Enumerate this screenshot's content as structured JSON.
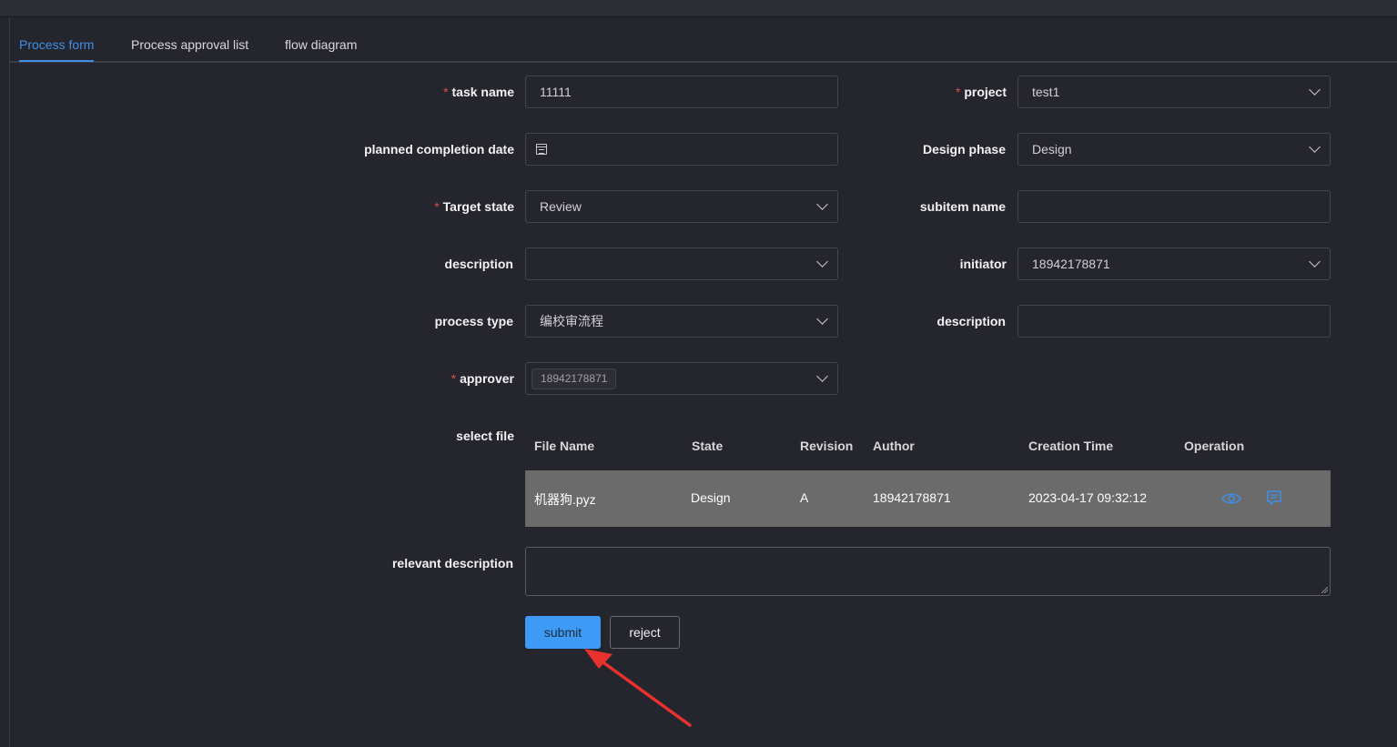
{
  "tabs": [
    {
      "label": "Process form",
      "active": true
    },
    {
      "label": "Process approval list",
      "active": false
    },
    {
      "label": "flow diagram",
      "active": false
    }
  ],
  "form": {
    "task_name": {
      "label": "task name",
      "required": "*",
      "value": "11111"
    },
    "project": {
      "label": "project",
      "required": "*",
      "value": "test1"
    },
    "planned_completion_date": {
      "label": "planned completion date",
      "value": ""
    },
    "design_phase": {
      "label": "Design phase",
      "value": "Design"
    },
    "target_state": {
      "label": "Target state",
      "required": "*",
      "value": "Review"
    },
    "subitem_name": {
      "label": "subitem name",
      "value": ""
    },
    "description_left": {
      "label": "description",
      "value": ""
    },
    "initiator": {
      "label": "initiator",
      "value": "18942178871"
    },
    "process_type": {
      "label": "process type",
      "value": "编校审流程"
    },
    "description_right": {
      "label": "description",
      "value": ""
    },
    "approver": {
      "label": "approver",
      "required": "*",
      "tag": "18942178871"
    },
    "select_file": {
      "label": "select file"
    },
    "relevant_description": {
      "label": "relevant description",
      "value": ""
    }
  },
  "file_table": {
    "columns": [
      "File Name",
      "State",
      "Revision",
      "Author",
      "Creation Time",
      "Operation"
    ],
    "rows": [
      {
        "file_name": "机器狗.pyz",
        "state": "Design",
        "revision": "A",
        "author": "18942178871",
        "creation_time": "2023-04-17 09:32:12",
        "operations": [
          "eye-icon",
          "comment-icon"
        ]
      }
    ]
  },
  "buttons": {
    "submit": "submit",
    "reject": "reject"
  },
  "colors": {
    "accent": "#3f8fe6",
    "primary_button": "#3d9af5",
    "required": "#e04b4b",
    "annotation_arrow": "#e8302f",
    "row_background": "#6b6b6b"
  }
}
